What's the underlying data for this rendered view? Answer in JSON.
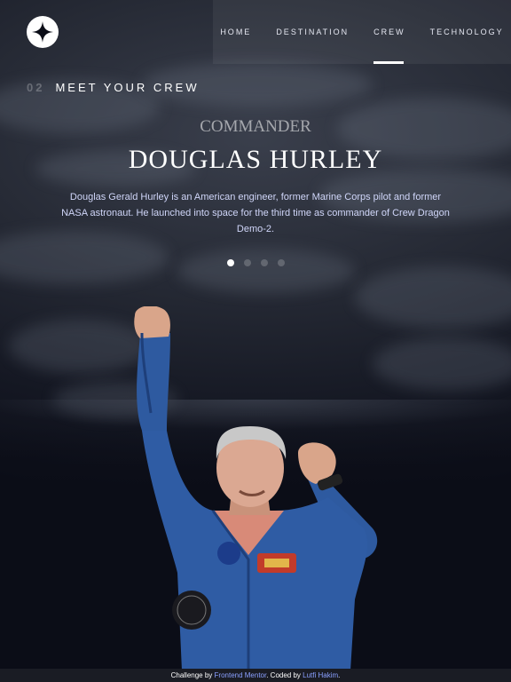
{
  "nav": {
    "items": [
      {
        "label": "HOME"
      },
      {
        "label": "DESTINATION"
      },
      {
        "label": "CREW",
        "active": true
      },
      {
        "label": "TECHNOLOGY"
      }
    ]
  },
  "heading": {
    "number": "02",
    "title": "MEET YOUR CREW"
  },
  "crew": {
    "role": "COMMANDER",
    "name": "DOUGLAS HURLEY",
    "bio": "Douglas Gerald Hurley is an American engineer, former Marine Corps pilot and former NASA astronaut. He launched into space for the third time as commander of Crew Dragon Demo-2.",
    "page_count": 4,
    "active_index": 0
  },
  "footer": {
    "prefix": "Challenge by ",
    "link1": "Frontend Mentor",
    "middle": ". Coded by ",
    "link2": "Lutfi Hakim",
    "suffix": "."
  },
  "icons": {
    "logo": "star-logo-icon"
  },
  "colors": {
    "background": "#0b0d17",
    "accent_text": "#d0d6f9",
    "link": "#8aa0ff"
  }
}
